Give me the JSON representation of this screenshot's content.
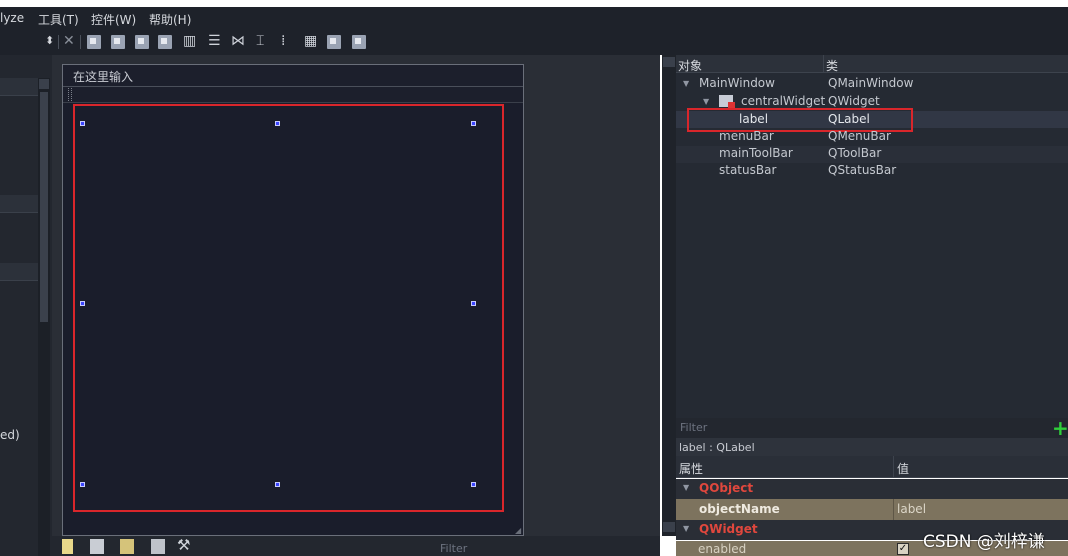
{
  "menubar": {
    "items": [
      "lyze",
      "工具(T)",
      "控件(W)",
      "帮助(H)"
    ]
  },
  "toolbar": {
    "icons": [
      "stepper-icon",
      "close-icon",
      "edit-widgets-icon",
      "edit-signals-icon",
      "edit-buddies-icon",
      "edit-tab-order-icon",
      "layout-horizontal-icon",
      "layout-vertical-icon",
      "layout-horizontal-splitter-icon",
      "layout-vertical-splitter-icon",
      "layout-form-icon",
      "layout-grid-icon",
      "break-layout-icon",
      "adjust-size-icon"
    ]
  },
  "left_panel": {
    "partial_text": "ed)"
  },
  "form": {
    "menubar_placeholder": "在这里输入"
  },
  "bottom": {
    "filter_placeholder": "Filter",
    "icons": [
      "new-file-icon",
      "copy-icon",
      "resource-icon",
      "delete-icon",
      "wrench-icon"
    ]
  },
  "object_inspector": {
    "headers": {
      "object": "对象",
      "class": "类"
    },
    "rows": [
      {
        "name": "MainWindow",
        "class": "QMainWindow"
      },
      {
        "name": "centralWidget",
        "class": "QWidget"
      },
      {
        "name": "label",
        "class": "QLabel"
      },
      {
        "name": "menuBar",
        "class": "QMenuBar"
      },
      {
        "name": "mainToolBar",
        "class": "QToolBar"
      },
      {
        "name": "statusBar",
        "class": "QStatusBar"
      }
    ]
  },
  "property_editor": {
    "filter_placeholder": "Filter",
    "current_object": "label : QLabel",
    "headers": {
      "property": "属性",
      "value": "值"
    },
    "sections": [
      {
        "category": "QObject",
        "properties": [
          {
            "name": "objectName",
            "value": "label"
          }
        ]
      },
      {
        "category": "QWidget",
        "properties": [
          {
            "name": "enabled",
            "value": "✓"
          }
        ]
      }
    ]
  },
  "watermark": "CSDN @刘梓谦",
  "colors": {
    "selection_outline": "#d9262b",
    "category_text": "#e0473d",
    "property_row_bg": "#7d735e",
    "add_button": "#2fcf3a"
  }
}
